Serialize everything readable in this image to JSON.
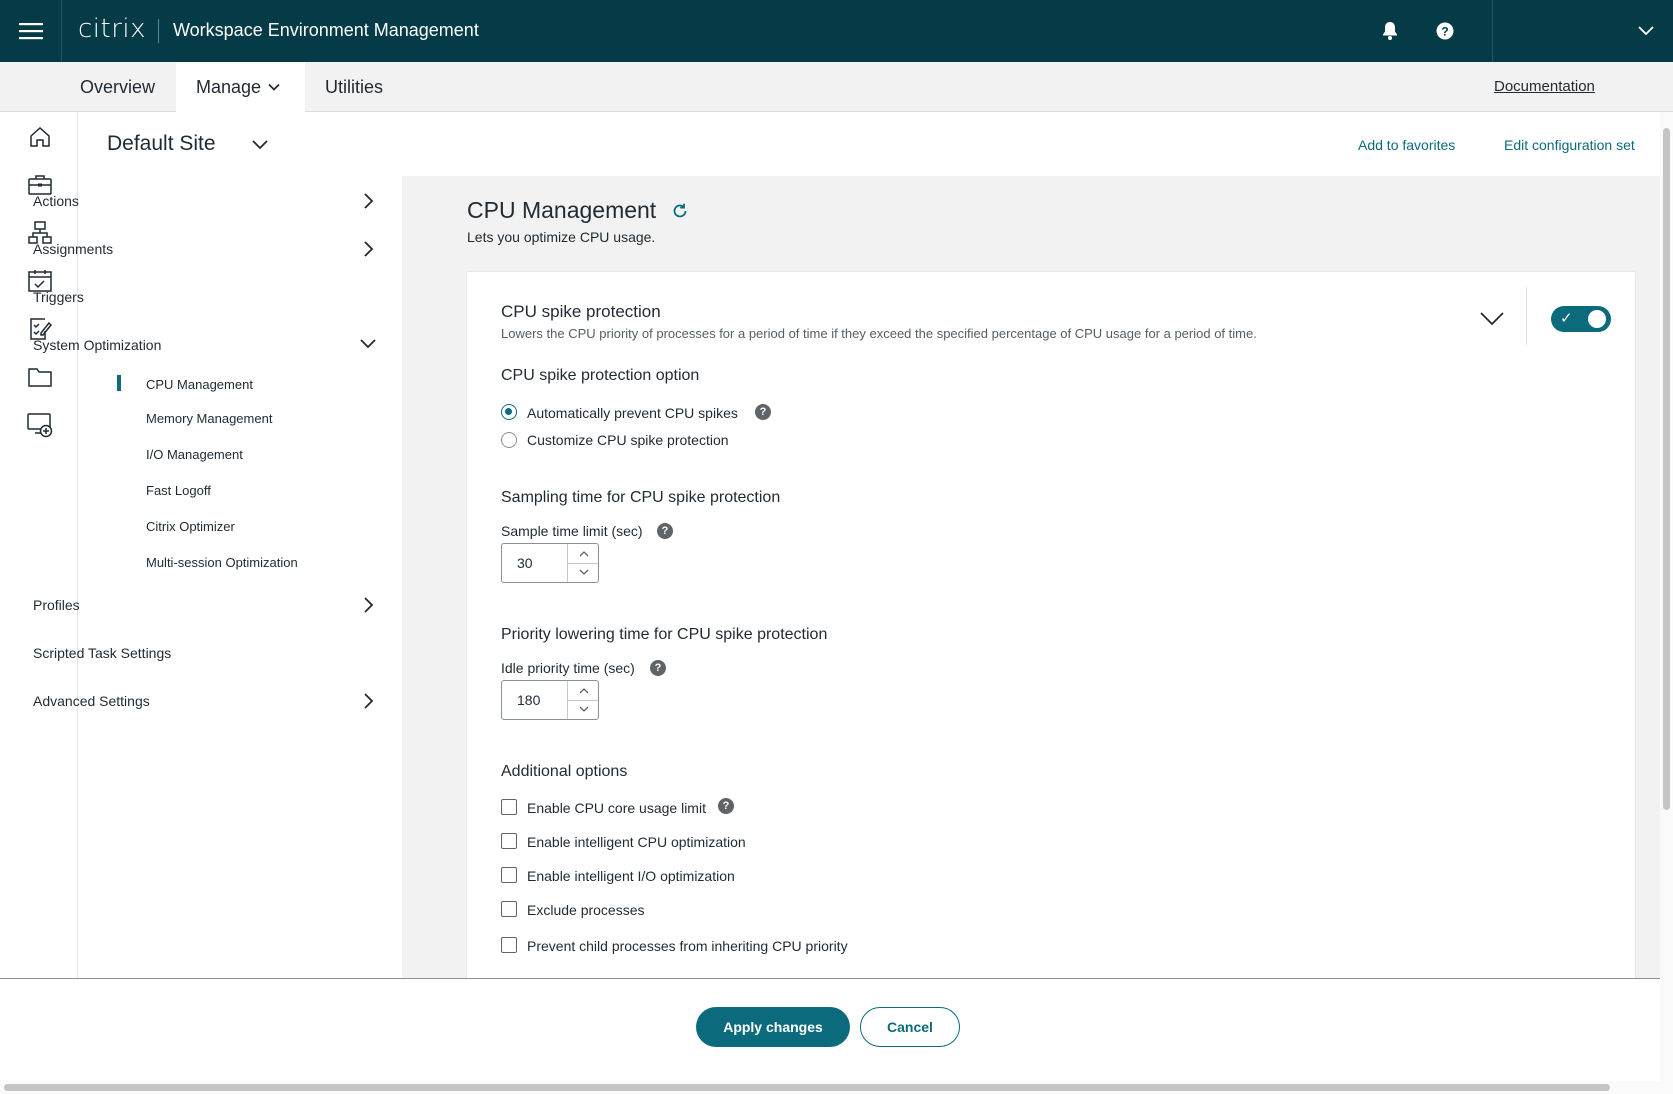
{
  "header": {
    "brand": "citrix",
    "app_title": "Workspace Environment Management"
  },
  "nav": {
    "tabs": [
      {
        "label": "Overview"
      },
      {
        "label": "Manage"
      },
      {
        "label": "Utilities"
      }
    ],
    "documentation": "Documentation"
  },
  "site": {
    "title": "Default Site",
    "add_favorites": "Add to favorites",
    "edit_config": "Edit configuration set"
  },
  "menu": {
    "items": [
      {
        "label": "Actions"
      },
      {
        "label": "Assignments"
      },
      {
        "label": "Triggers"
      },
      {
        "label": "System Optimization"
      },
      {
        "label": "Profiles"
      },
      {
        "label": "Scripted Task Settings"
      },
      {
        "label": "Advanced Settings"
      }
    ],
    "sub_items": [
      {
        "label": "CPU Management"
      },
      {
        "label": "Memory Management"
      },
      {
        "label": "I/O Management"
      },
      {
        "label": "Fast Logoff"
      },
      {
        "label": "Citrix Optimizer"
      },
      {
        "label": "Multi-session Optimization"
      }
    ]
  },
  "page": {
    "title": "CPU Management",
    "subtitle": "Lets you optimize CPU usage."
  },
  "card": {
    "title": "CPU spike protection",
    "description": "Lowers the CPU priority of processes for a period of time if they exceed the specified percentage of CPU usage for a period of time.",
    "option_heading": "CPU spike protection option",
    "radio_auto": "Automatically prevent CPU spikes",
    "radio_custom": "Customize CPU spike protection",
    "sampling_heading": "Sampling time for CPU spike protection",
    "sample_label": "Sample time limit (sec)",
    "sample_value": "30",
    "priority_heading": "Priority lowering time for CPU spike protection",
    "idle_label": "Idle priority time (sec)",
    "idle_value": "180",
    "additional_heading": "Additional options",
    "checkboxes": [
      {
        "label": "Enable CPU core usage limit"
      },
      {
        "label": "Enable intelligent CPU optimization"
      },
      {
        "label": "Enable intelligent I/O optimization"
      },
      {
        "label": "Exclude processes"
      },
      {
        "label": "Prevent child processes from inheriting CPU priority"
      }
    ],
    "help_glyph": "?"
  },
  "footer": {
    "apply": "Apply changes",
    "cancel": "Cancel"
  },
  "colors": {
    "header_bg": "#053a47",
    "accent": "#0b6b7c"
  }
}
